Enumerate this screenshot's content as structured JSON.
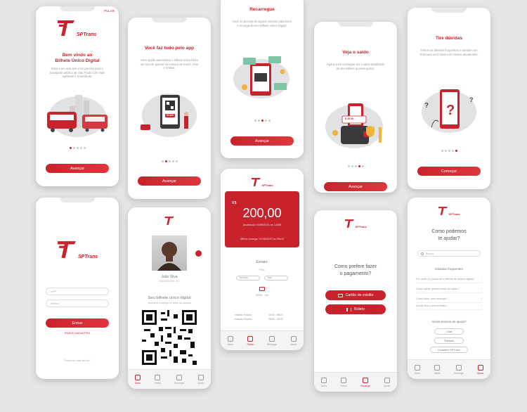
{
  "brand": {
    "name": "SPTrans",
    "accent": "#c8232c"
  },
  "welcome": {
    "skip": "PULAR",
    "title_line1": "Bem vindo ao",
    "title_line2": "Bilhete Único Digital",
    "text": "Esse é um app que você precisa para o transporte público de São Paulo com mais agilidade e praticidade.",
    "button": "Avançar"
  },
  "do_all": {
    "title": "Você faz tudo pelo app",
    "text": "Uma opção automática o bilhete único físico na hora de passar na catraca do metrô, trem e ônibus.",
    "button": "Avançar",
    "qr_label": "SCAN"
  },
  "recharge": {
    "title": "Recarregue",
    "text": "Você só precisa de alguns minutos para fazer a recarga do seu Bilhete Único Digital.",
    "button": "Avançar"
  },
  "balance": {
    "title": "Veja o saldo",
    "text": "Agora você consegue ver o saldo atualizado do seu bilhete quando quiser.",
    "button": "Avançar",
    "amount_chip": "$ 45,00"
  },
  "doubts": {
    "title": "Tire dúvidas",
    "text": "Temos as dúvidas frequentes e também um chat para você falar com nossos atendentes.",
    "button": "Começar"
  },
  "login": {
    "cpf_placeholder": "CPF",
    "password_placeholder": "Senha",
    "button": "Entrar",
    "register": "FAZER CADASTRO",
    "forgot": "Esqueceu sua senha?"
  },
  "card": {
    "user_name": "João Silva",
    "user_id": "000.000.000 - 00",
    "title": "Seu bilhete único digital",
    "subtitle": "Aproxime o código no leitor da catraca",
    "tabs": [
      "Ínicio",
      "Saldo",
      "Recarga",
      "Ajuda"
    ]
  },
  "wallet": {
    "currency": "R$",
    "amount": "200,00",
    "updated": "Atualizado 09/05/2020 às 13h58",
    "last_recharge": "Última recarga: 01/05/2020 às 08h12",
    "statement_title": "Extrato:",
    "filter_label": "Filtro",
    "filter1": "Recarga",
    "filter2": "Data",
    "entry1": "09/05 - 13h",
    "entry2_label": "estação Paraíso",
    "entry2_time": "09/05 - 08h21",
    "entry3_label": "estação Paraíso",
    "entry3_time": "08/05 - 18h32",
    "tabs": [
      "Ínicio",
      "Saldo",
      "Recarga",
      "Ajuda"
    ]
  },
  "payment": {
    "title_line1": "Como prefere fazer",
    "title_line2": "o pagamento?",
    "option1": "Cartão de crédito",
    "option2": "Boleto",
    "tabs": [
      "Ínicio",
      "Saldo",
      "Recarga",
      "Ajuda"
    ]
  },
  "help": {
    "title_line1": "Como podemos",
    "title_line2": "te ajudar?",
    "search": "Buscar",
    "faq_title": "Dúvidas frequentes",
    "faq": [
      "Por onde eu posso ter o bilhete de ônibus digital?",
      "Como saber quanto tenho de saldo?",
      "Como fazer uma recarga?",
      "Aonde fica o meu extrato?"
    ],
    "need_help": "Ainda precisa de ajuda?",
    "options": [
      "Chat",
      "Telefone",
      "Unidades SPTrans"
    ],
    "tabs": [
      "Ínicio",
      "Saldo",
      "Recarga",
      "Ajuda"
    ]
  }
}
